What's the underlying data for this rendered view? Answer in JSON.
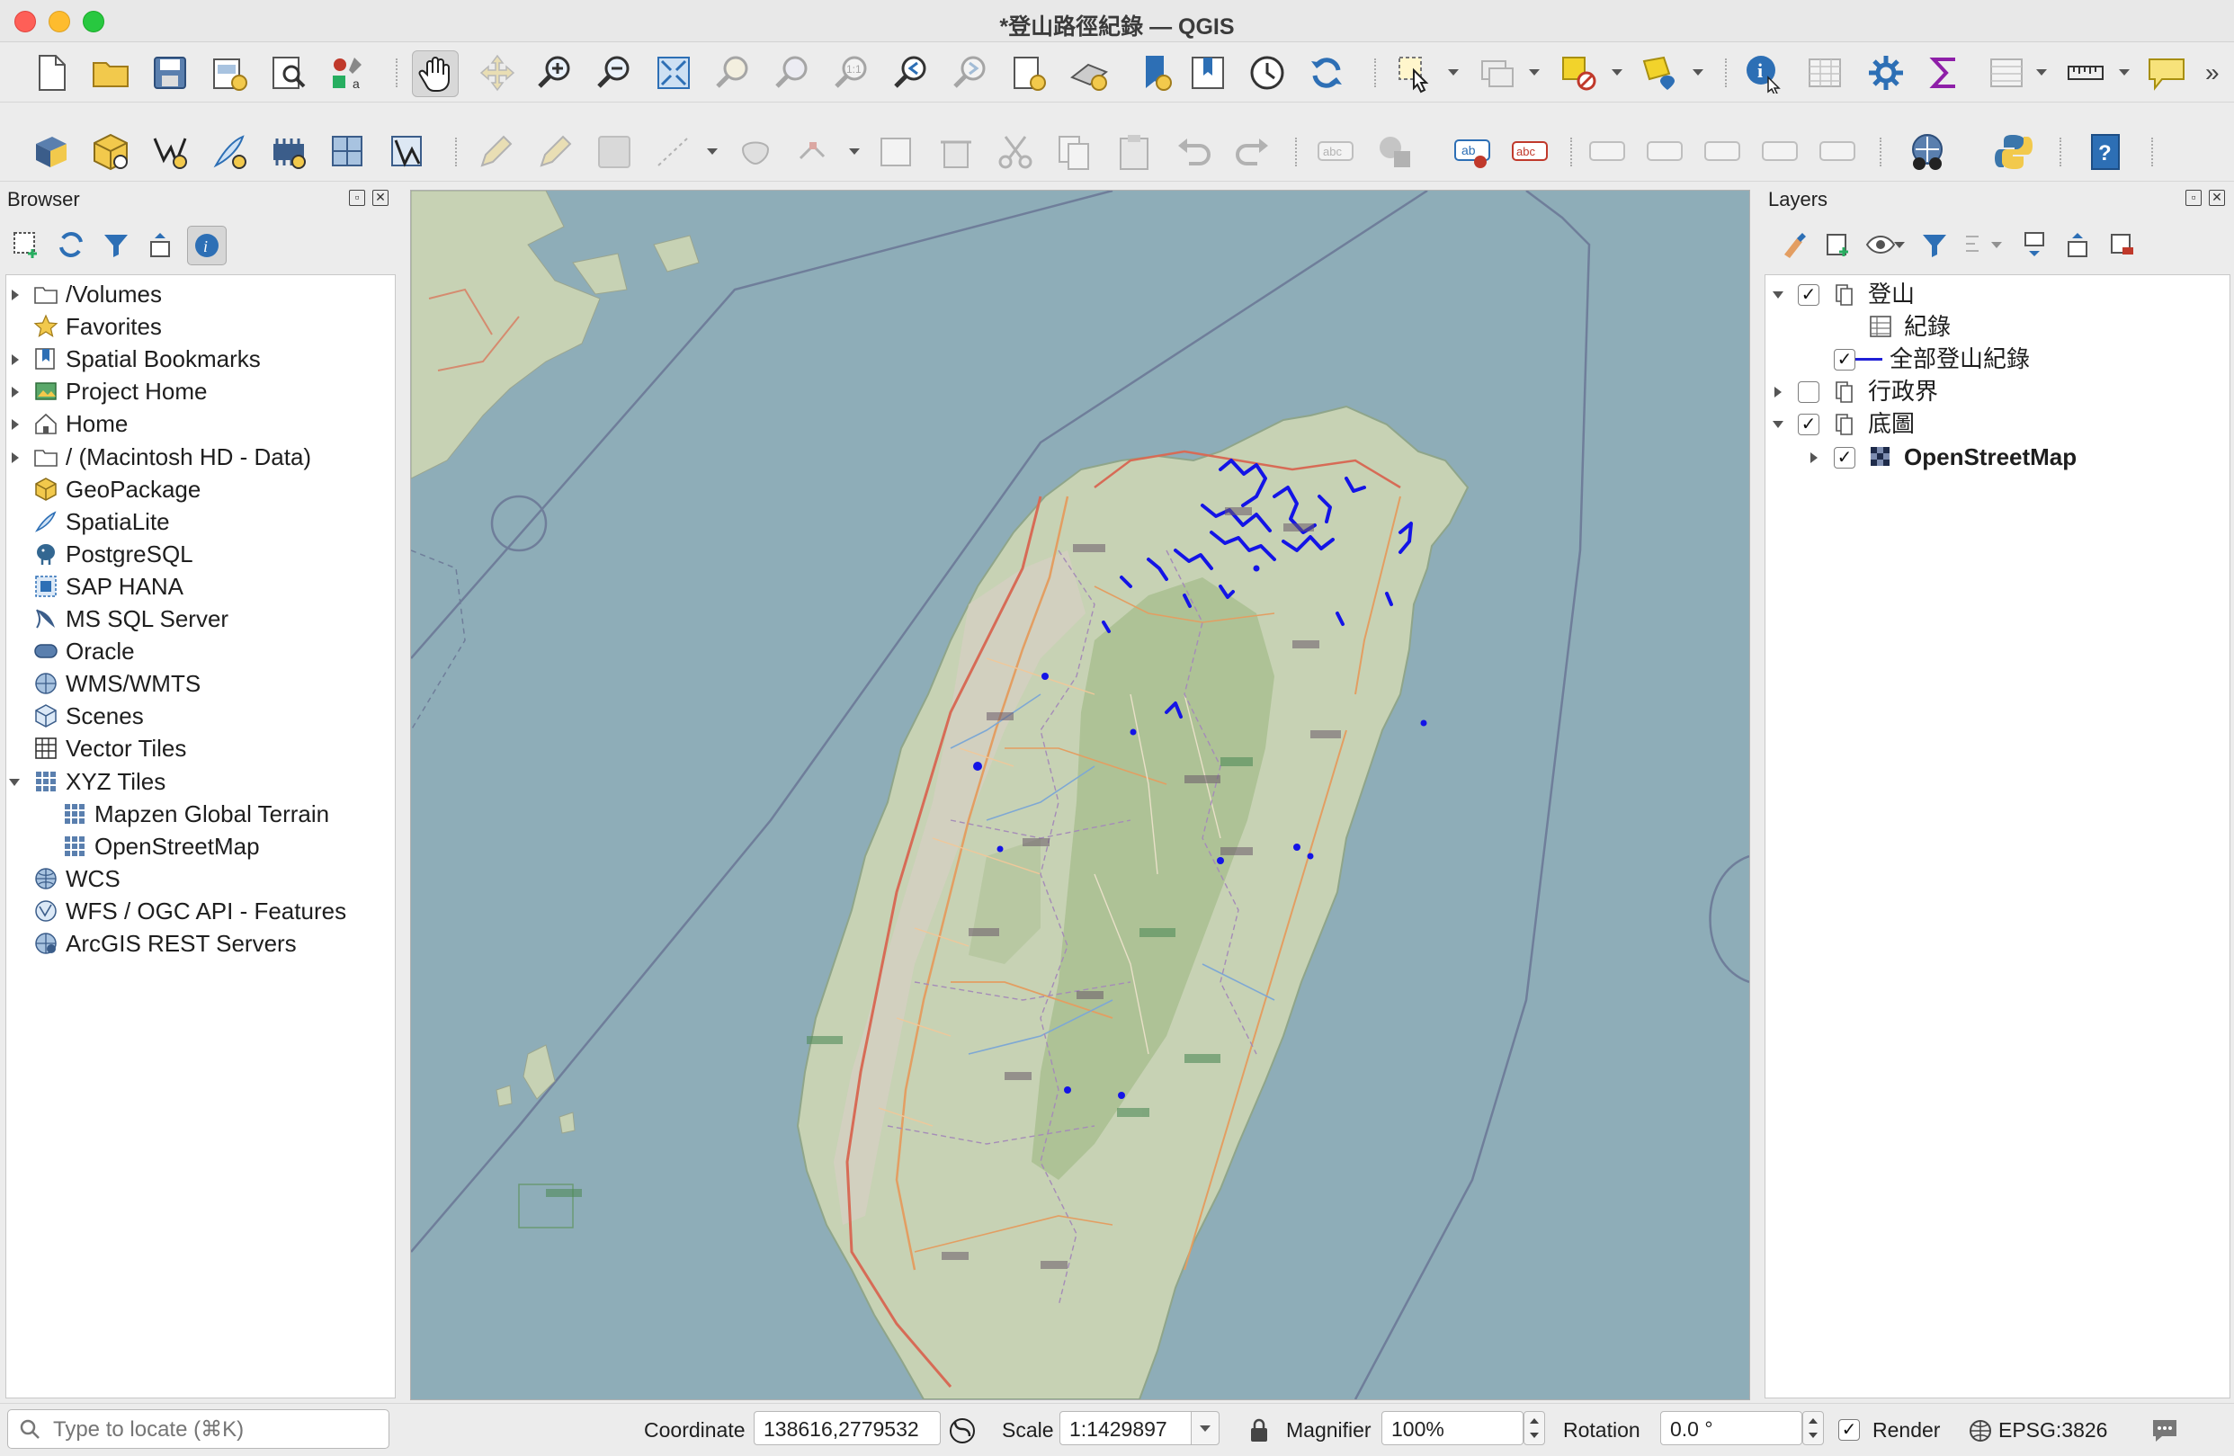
{
  "window": {
    "title": "*登山路徑紀錄 — QGIS"
  },
  "toolbar1": {
    "icons": [
      "new-project-icon",
      "open-project-icon",
      "save-project-icon",
      "new-print-layout-icon",
      "layout-manager-icon",
      "style-manager-icon",
      "pan-icon",
      "pan-to-selection-icon",
      "zoom-in-icon",
      "zoom-out-icon",
      "zoom-full-icon",
      "zoom-to-selection-icon",
      "zoom-to-layer-icon",
      "zoom-native-icon",
      "zoom-last-icon",
      "zoom-next-icon",
      "new-map-view-icon",
      "new-3d-map-view-icon",
      "new-bookmark-icon",
      "show-bookmarks-icon",
      "temporal-controller-icon",
      "refresh-icon",
      "select-feature-icon",
      "deselect-icon",
      "select-by-expression-icon",
      "select-by-location-icon",
      "identify-icon",
      "attribute-table-icon",
      "processing-toolbox-icon",
      "statistics-icon",
      "open-field-calculator-icon",
      "measure-icon",
      "map-tips-icon"
    ]
  },
  "toolbar2": {
    "icons": [
      "data-source-manager-icon",
      "new-geopackage-layer-icon",
      "new-shapefile-layer-icon",
      "new-spatialite-layer-icon",
      "new-temporary-layer-icon",
      "new-virtual-layer-icon",
      "new-mesh-layer-icon",
      "current-edits-icon",
      "toggle-editing-icon",
      "save-edits-icon",
      "digitize-icon",
      "add-feature-icon",
      "vertex-tool-icon",
      "modify-attributes-icon",
      "delete-selected-icon",
      "cut-features-icon",
      "copy-features-icon",
      "paste-features-icon",
      "undo-icon",
      "redo-icon",
      "label-toolbar-icon",
      "layer-diagram-icon",
      "label-highlight-icon",
      "label-unplaced-icon",
      "pin-labels-icon",
      "show-hide-labels-icon",
      "move-label-icon",
      "rotate-label-icon",
      "change-label-icon",
      "metasearch-icon",
      "python-console-icon",
      "help-icon"
    ]
  },
  "browser": {
    "title": "Browser",
    "items": [
      {
        "label": "/Volumes",
        "icon": "folder-icon",
        "expand": "collapsed"
      },
      {
        "label": "Favorites",
        "icon": "star-icon",
        "expand": "none"
      },
      {
        "label": "Spatial Bookmarks",
        "icon": "bookmark-icon",
        "expand": "collapsed"
      },
      {
        "label": "Project Home",
        "icon": "project-home-icon",
        "expand": "collapsed"
      },
      {
        "label": "Home",
        "icon": "home-icon",
        "expand": "collapsed"
      },
      {
        "label": "/ (Macintosh HD - Data)",
        "icon": "folder-icon",
        "expand": "collapsed"
      },
      {
        "label": "GeoPackage",
        "icon": "geopackage-icon",
        "expand": "none"
      },
      {
        "label": "SpatiaLite",
        "icon": "spatialite-icon",
        "expand": "none"
      },
      {
        "label": "PostgreSQL",
        "icon": "postgresql-icon",
        "expand": "none"
      },
      {
        "label": "SAP HANA",
        "icon": "sap-hana-icon",
        "expand": "none"
      },
      {
        "label": "MS SQL Server",
        "icon": "mssql-icon",
        "expand": "none"
      },
      {
        "label": "Oracle",
        "icon": "oracle-icon",
        "expand": "none"
      },
      {
        "label": "WMS/WMTS",
        "icon": "wms-icon",
        "expand": "none"
      },
      {
        "label": "Scenes",
        "icon": "scenes-icon",
        "expand": "none"
      },
      {
        "label": "Vector Tiles",
        "icon": "vector-tiles-icon",
        "expand": "none"
      },
      {
        "label": "XYZ Tiles",
        "icon": "xyz-tiles-icon",
        "expand": "expanded"
      },
      {
        "label": "Mapzen Global Terrain",
        "icon": "xyz-tiles-icon",
        "expand": "child"
      },
      {
        "label": "OpenStreetMap",
        "icon": "xyz-tiles-icon",
        "expand": "child"
      },
      {
        "label": "WCS",
        "icon": "wcs-icon",
        "expand": "none"
      },
      {
        "label": "WFS / OGC API - Features",
        "icon": "wfs-icon",
        "expand": "none"
      },
      {
        "label": "ArcGIS REST Servers",
        "icon": "arcgis-icon",
        "expand": "none"
      }
    ],
    "locator_placeholder": "Type to locate (⌘K)"
  },
  "layers": {
    "title": "Layers",
    "items": [
      {
        "label": "登山",
        "type": "group",
        "checked": true,
        "expand": "expanded",
        "level": 0
      },
      {
        "label": "紀錄",
        "type": "table",
        "checked": null,
        "expand": "none",
        "level": 1
      },
      {
        "label": "全部登山紀錄",
        "type": "line",
        "checked": true,
        "expand": "none",
        "level": 1,
        "color": "#1f1fd6"
      },
      {
        "label": "行政界",
        "type": "group",
        "checked": false,
        "expand": "collapsed",
        "level": 0
      },
      {
        "label": "底圖",
        "type": "group",
        "checked": true,
        "expand": "expanded",
        "level": 0
      },
      {
        "label": "OpenStreetMap",
        "type": "raster",
        "checked": true,
        "expand": "collapsed",
        "level": 1,
        "bold": true
      }
    ]
  },
  "status": {
    "coordinate_label": "Coordinate",
    "coordinate_value": "138616,2779532",
    "scale_label": "Scale",
    "scale_value": "1:1429897",
    "magnifier_label": "Magnifier",
    "magnifier_value": "100%",
    "rotation_label": "Rotation",
    "rotation_value": "0.0 °",
    "render_label": "Render",
    "render_checked": true,
    "crs": "EPSG:3826"
  },
  "map": {
    "sea_color": "#8eadb8",
    "land_color": "#c7d2b4",
    "forest_color": "#a9bf91",
    "track_color": "#1414e6"
  }
}
